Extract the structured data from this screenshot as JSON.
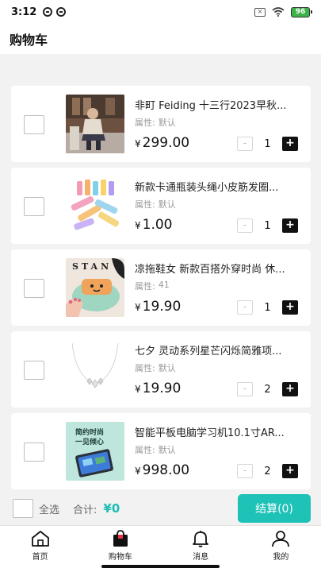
{
  "status_bar": {
    "time": "3:12",
    "battery": "96"
  },
  "header": {
    "title": "购物车"
  },
  "cart": {
    "items": [
      {
        "name": "非町 Feiding 十三行2023早秋...",
        "attr_label": "属性:",
        "attr_value": "默认",
        "currency": "¥",
        "price": "299.00",
        "qty": "1",
        "minus": "-",
        "plus": "+"
      },
      {
        "name": "新款卡通瓶装头绳小皮筋发圈...",
        "attr_label": "属性:",
        "attr_value": "默认",
        "currency": "¥",
        "price": "1.00",
        "qty": "1",
        "minus": "-",
        "plus": "+"
      },
      {
        "name": "凉拖鞋女 新款百搭外穿时尚 休...",
        "attr_label": "属性:",
        "attr_value": "41",
        "currency": "¥",
        "price": "19.90",
        "qty": "1",
        "minus": "-",
        "plus": "+"
      },
      {
        "name": "七夕 灵动系列星芒闪烁简雅项...",
        "attr_label": "属性:",
        "attr_value": "默认",
        "currency": "¥",
        "price": "19.90",
        "qty": "2",
        "minus": "-",
        "plus": "+"
      },
      {
        "name": "智能平板电脑学习机10.1寸AR...",
        "attr_label": "属性:",
        "attr_value": "默认",
        "currency": "¥",
        "price": "998.00",
        "qty": "2",
        "minus": "-",
        "plus": "+"
      }
    ],
    "thumb_text": {
      "slipper": "STAN",
      "tablet_line1": "简约时尚",
      "tablet_line2": "一见倾心"
    }
  },
  "checkout": {
    "select_all": "全选",
    "total_label": "合计:",
    "total_value": "¥0",
    "button": "结算(0)"
  },
  "tabbar": [
    {
      "label": "首页",
      "icon": "home-icon"
    },
    {
      "label": "购物车",
      "icon": "cart-bag-icon"
    },
    {
      "label": "消息",
      "icon": "bell-icon"
    },
    {
      "label": "我的",
      "icon": "user-icon"
    }
  ],
  "colors": {
    "accent": "#1ec2b7",
    "total": "#1dbfb5",
    "page_bg": "#f2f2f2"
  }
}
